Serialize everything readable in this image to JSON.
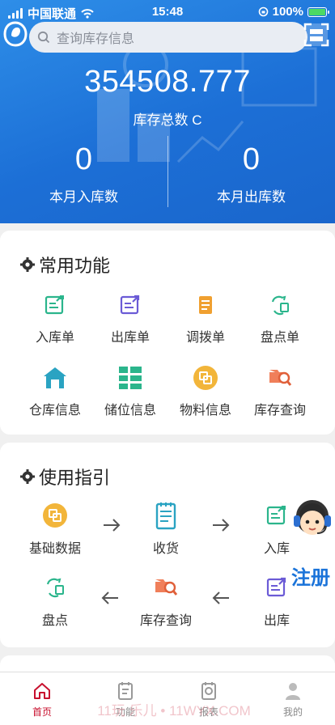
{
  "status_bar": {
    "carrier": "中国联通",
    "time": "15:48",
    "battery": "100%"
  },
  "search": {
    "placeholder": "查询库存信息"
  },
  "summary": {
    "total_value": "354508.777",
    "total_label": "库存总数 C",
    "month_in_value": "0",
    "month_in_label": "本月入库数",
    "month_out_value": "0",
    "month_out_label": "本月出库数"
  },
  "common": {
    "title": "常用功能",
    "items": [
      {
        "label": "入库单",
        "icon": "inbound-doc-icon"
      },
      {
        "label": "出库单",
        "icon": "outbound-doc-icon"
      },
      {
        "label": "调拨单",
        "icon": "transfer-doc-icon"
      },
      {
        "label": "盘点单",
        "icon": "inventory-check-icon"
      },
      {
        "label": "仓库信息",
        "icon": "warehouse-icon"
      },
      {
        "label": "储位信息",
        "icon": "location-grid-icon"
      },
      {
        "label": "物料信息",
        "icon": "material-icon"
      },
      {
        "label": "库存查询",
        "icon": "stock-search-icon"
      }
    ]
  },
  "guide": {
    "title": "使用指引",
    "items": [
      {
        "label": "基础数据",
        "icon": "base-data-icon"
      },
      {
        "label": "收货",
        "icon": "receive-icon"
      },
      {
        "label": "入库",
        "icon": "inbound-icon"
      },
      {
        "label": "出库",
        "icon": "outbound-icon"
      },
      {
        "label": "库存查询",
        "icon": "stock-search-icon"
      },
      {
        "label": "盘点",
        "icon": "inventory-check-icon"
      }
    ]
  },
  "float": {
    "register_label": "注册"
  },
  "tabbar": {
    "items": [
      {
        "label": "首页",
        "icon": "home-icon",
        "active": true
      },
      {
        "label": "功能",
        "icon": "function-icon",
        "active": false
      },
      {
        "label": "报表",
        "icon": "report-icon",
        "active": false
      },
      {
        "label": "我的",
        "icon": "user-icon",
        "active": false
      }
    ],
    "watermark": "11玩 乐儿 • 11WYX.COM"
  },
  "colors": {
    "brand_blue": "#1c6fd6",
    "active_tab": "#c8102e",
    "icon_green": "#2bb58c",
    "icon_orange": "#f0a030"
  }
}
